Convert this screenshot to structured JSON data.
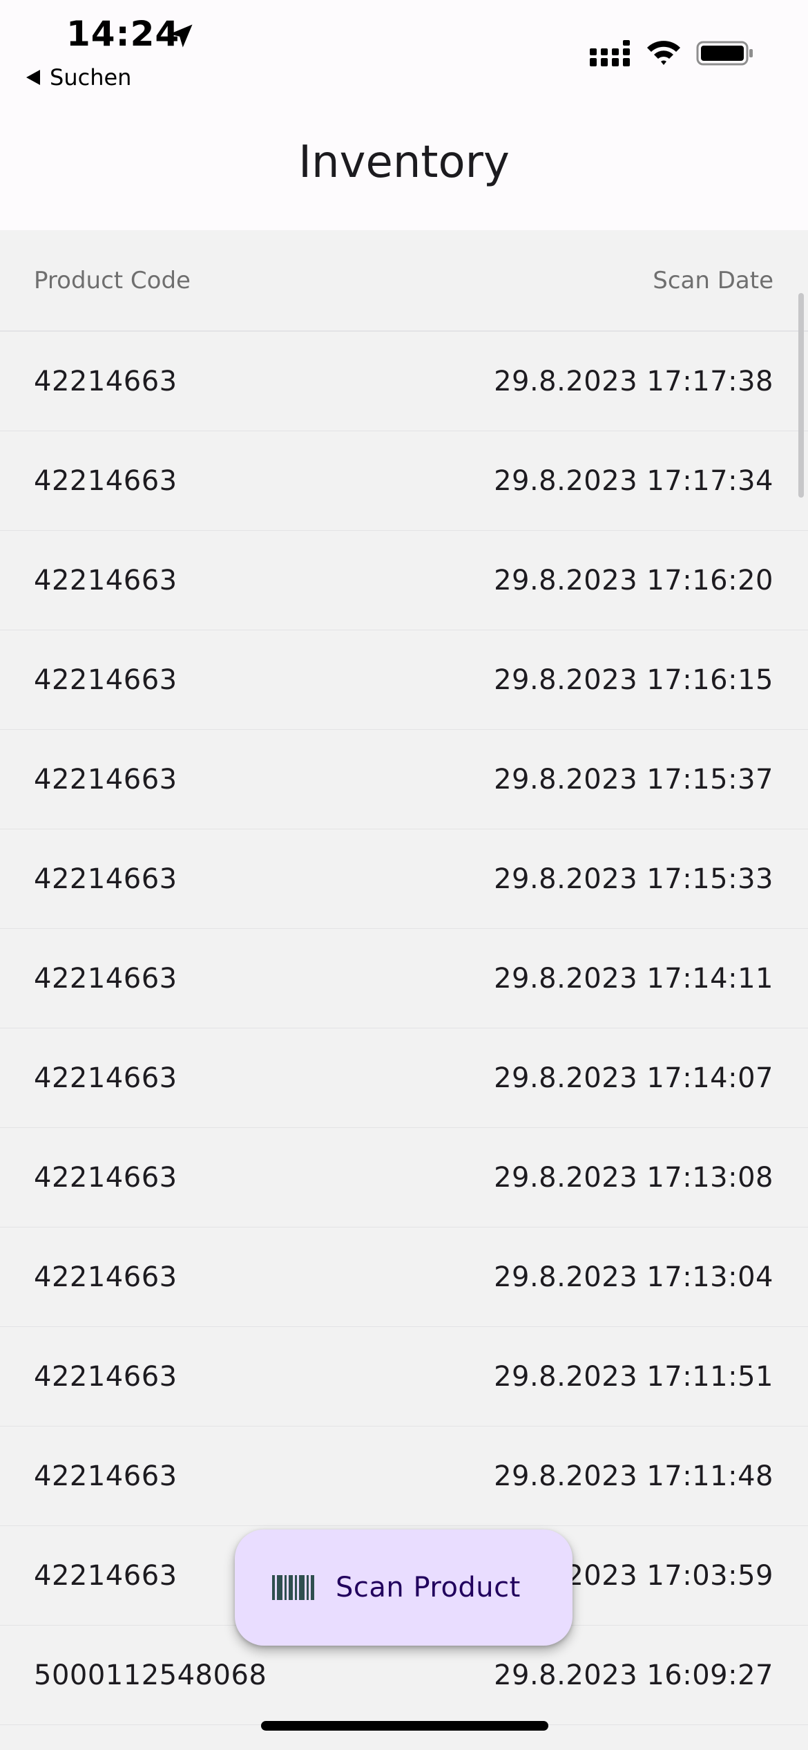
{
  "status_bar": {
    "time": "14:24",
    "back_label": "Suchen",
    "icons": [
      "location-arrow-icon",
      "cellular-signal-icon",
      "wifi-icon",
      "battery-icon"
    ]
  },
  "app_bar": {
    "title": "Inventory"
  },
  "table": {
    "columns": [
      "Product Code",
      "Scan Date"
    ],
    "rows": [
      {
        "code": "42214663",
        "date": "29.8.2023 17:17:38"
      },
      {
        "code": "42214663",
        "date": "29.8.2023 17:17:34"
      },
      {
        "code": "42214663",
        "date": "29.8.2023 17:16:20"
      },
      {
        "code": "42214663",
        "date": "29.8.2023 17:16:15"
      },
      {
        "code": "42214663",
        "date": "29.8.2023 17:15:37"
      },
      {
        "code": "42214663",
        "date": "29.8.2023 17:15:33"
      },
      {
        "code": "42214663",
        "date": "29.8.2023 17:14:11"
      },
      {
        "code": "42214663",
        "date": "29.8.2023 17:14:07"
      },
      {
        "code": "42214663",
        "date": "29.8.2023 17:13:08"
      },
      {
        "code": "42214663",
        "date": "29.8.2023 17:13:04"
      },
      {
        "code": "42214663",
        "date": "29.8.2023 17:11:51"
      },
      {
        "code": "42214663",
        "date": "29.8.2023 17:11:48"
      },
      {
        "code": "42214663",
        "date": "29.8.2023 17:03:59"
      },
      {
        "code": "5000112548068",
        "date": "29.8.2023 16:09:27"
      },
      {
        "code": "",
        "date": ""
      }
    ]
  },
  "fab": {
    "label": "Scan Product",
    "icon": "barcode-icon"
  },
  "colors": {
    "surface": "#fdfbfd",
    "background": "#f2f2f2",
    "fab_container": "#e9ddff",
    "fab_content": "#21005d",
    "barcode_icon": "#2f4f4f"
  }
}
